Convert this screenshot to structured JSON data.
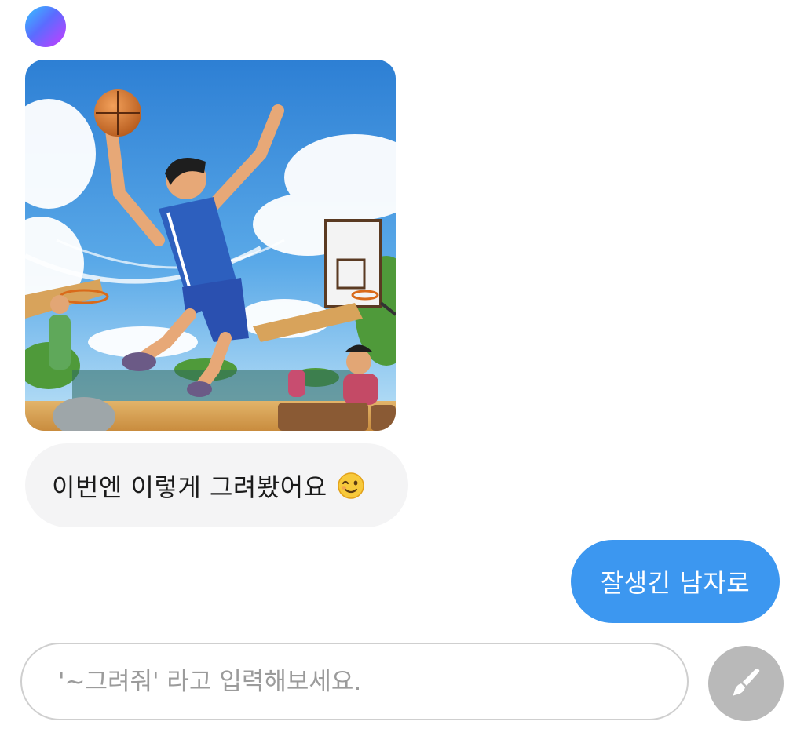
{
  "chat": {
    "bot_image_alt": "",
    "bot_message": "이번엔 이렇게 그려봤어요",
    "bot_message_emoji": "winking-face-emoji",
    "user_message": "잘생긴 남자로"
  },
  "composer": {
    "placeholder": "'~그려줘' 라고 입력해보세요.",
    "value": "",
    "send_icon": "paintbrush-icon"
  },
  "colors": {
    "user_bubble": "#3c97f0",
    "bot_bubble": "#f4f4f5",
    "draw_button": "#b9b9b9"
  }
}
